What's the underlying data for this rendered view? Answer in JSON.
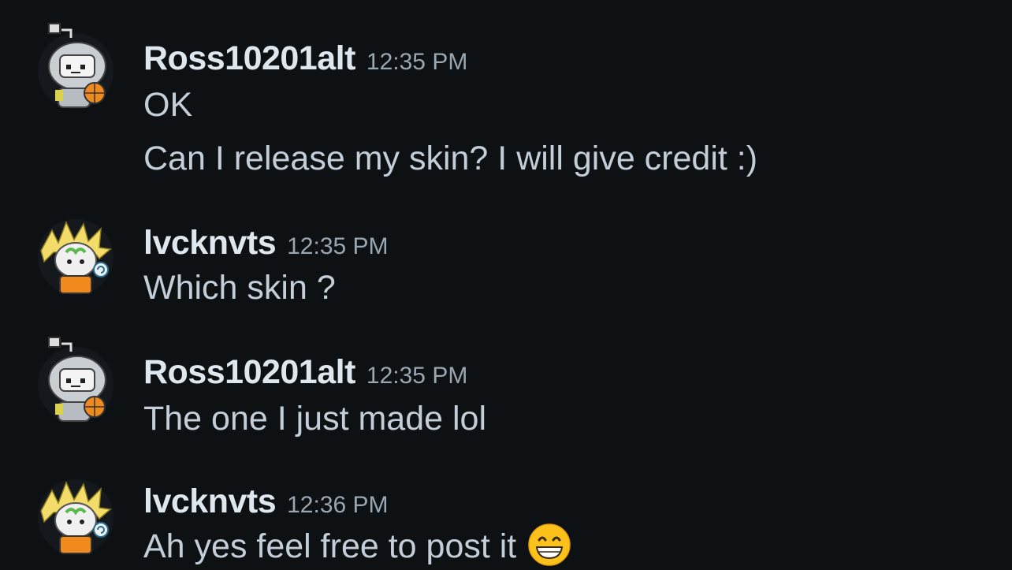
{
  "messages": [
    {
      "username": "Ross10201alt",
      "time": "12:35 PM",
      "avatar": "astronaut-avatar",
      "lines": [
        "OK",
        "Can I release my skin? I will give credit :)"
      ]
    },
    {
      "username": "lvcknvts",
      "time": "12:35 PM",
      "avatar": "blonde-avatar",
      "lines": [
        "Which skin ?"
      ]
    },
    {
      "username": "Ross10201alt",
      "time": "12:35 PM",
      "avatar": "astronaut-avatar",
      "lines": [
        "The one I just made lol"
      ]
    },
    {
      "username": "lvcknvts",
      "time": "12:36 PM",
      "avatar": "blonde-avatar",
      "lines": [
        "Ah yes feel free to post it"
      ],
      "emoji": "grinning-face-emoji"
    }
  ],
  "colors": {
    "background": "#0e1114",
    "username": "#dfe7ee",
    "timestamp": "#9aa6b0",
    "message": "#c3ced8"
  }
}
